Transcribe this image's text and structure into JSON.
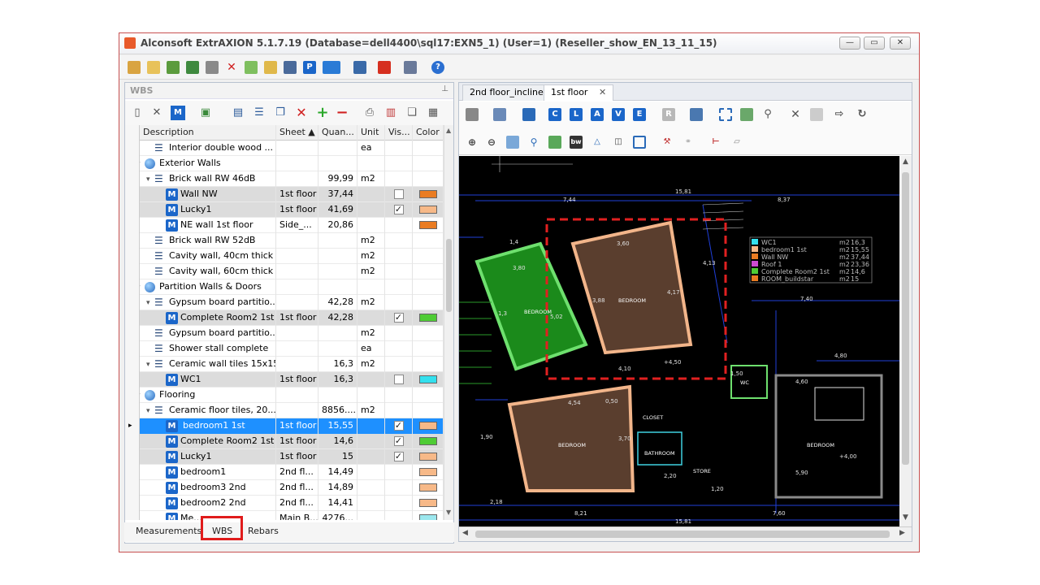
{
  "window": {
    "title": "Alconsoft ExtrAXION 5.1.7.19 (Database=dell4400\\sql17:EXN5_1) (User=1) (Reseller_show_EN_13_11_15)"
  },
  "wbs": {
    "title": "WBS",
    "pin": "⊥",
    "columns": [
      "Description",
      "Sheet ▲",
      "Quan...",
      "Unit",
      "Vis...",
      "Color"
    ],
    "rows": [
      {
        "icon": "list",
        "indent": 2,
        "desc": "Interior double wood ...",
        "sheet": "",
        "qty": "",
        "unit": "ea",
        "vis": "",
        "color": "",
        "style": ""
      },
      {
        "icon": "globe",
        "indent": 1,
        "desc": "Exterior Walls",
        "sheet": "",
        "qty": "",
        "unit": "",
        "vis": "",
        "color": "",
        "style": "",
        "tw": "▾"
      },
      {
        "icon": "list",
        "indent": 2,
        "desc": "Brick wall RW 46dB",
        "sheet": "",
        "qty": "99,99",
        "unit": "m2",
        "vis": "",
        "color": "",
        "style": "",
        "tw": "▾"
      },
      {
        "icon": "m",
        "indent": 3,
        "desc": "Wall NW",
        "sheet": "1st floor",
        "qty": "37,44",
        "unit": "",
        "vis": "☐",
        "color": "#ea7c22",
        "style": "gray"
      },
      {
        "icon": "m",
        "indent": 3,
        "desc": "Lucky1",
        "sheet": "1st floor",
        "qty": "41,69",
        "unit": "",
        "vis": "✓",
        "color": "#f7b988",
        "style": "gray"
      },
      {
        "icon": "m",
        "indent": 3,
        "desc": "NE wall 1st floor",
        "sheet": "Side_...",
        "qty": "20,86",
        "unit": "",
        "vis": "",
        "color": "#ea7c22",
        "style": ""
      },
      {
        "icon": "list",
        "indent": 2,
        "desc": "Brick wall RW 52dB",
        "sheet": "",
        "qty": "",
        "unit": "m2",
        "vis": "",
        "color": "",
        "style": ""
      },
      {
        "icon": "list",
        "indent": 2,
        "desc": "Cavity wall, 40cm thick",
        "sheet": "",
        "qty": "",
        "unit": "m2",
        "vis": "",
        "color": "",
        "style": ""
      },
      {
        "icon": "list",
        "indent": 2,
        "desc": "Cavity wall, 60cm thick",
        "sheet": "",
        "qty": "",
        "unit": "m2",
        "vis": "",
        "color": "",
        "style": ""
      },
      {
        "icon": "globe",
        "indent": 1,
        "desc": "Partition Walls & Doors",
        "sheet": "",
        "qty": "",
        "unit": "",
        "vis": "",
        "color": "",
        "style": "",
        "tw": "▾"
      },
      {
        "icon": "list",
        "indent": 2,
        "desc": "Gypsum board partitio...",
        "sheet": "",
        "qty": "42,28",
        "unit": "m2",
        "vis": "",
        "color": "",
        "style": "",
        "tw": "▾"
      },
      {
        "icon": "m",
        "indent": 3,
        "desc": "Complete Room2 1st",
        "sheet": "1st floor",
        "qty": "42,28",
        "unit": "",
        "vis": "✓",
        "color": "#4fcc35",
        "style": "gray"
      },
      {
        "icon": "list",
        "indent": 2,
        "desc": "Gypsum board partitio...",
        "sheet": "",
        "qty": "",
        "unit": "m2",
        "vis": "",
        "color": "",
        "style": ""
      },
      {
        "icon": "list",
        "indent": 2,
        "desc": "Shower stall complete",
        "sheet": "",
        "qty": "",
        "unit": "ea",
        "vis": "",
        "color": "",
        "style": ""
      },
      {
        "icon": "list",
        "indent": 2,
        "desc": "Ceramic wall tiles 15x15",
        "sheet": "",
        "qty": "16,3",
        "unit": "m2",
        "vis": "",
        "color": "",
        "style": "",
        "tw": "▾"
      },
      {
        "icon": "m",
        "indent": 3,
        "desc": "WC1",
        "sheet": "1st floor",
        "qty": "16,3",
        "unit": "",
        "vis": "☐",
        "color": "#33e0ee",
        "style": "gray"
      },
      {
        "icon": "globe",
        "indent": 1,
        "desc": "Flooring",
        "sheet": "",
        "qty": "",
        "unit": "",
        "vis": "",
        "color": "",
        "style": "",
        "tw": "▾"
      },
      {
        "icon": "list",
        "indent": 2,
        "desc": "Ceramic floor tiles, 20...",
        "sheet": "",
        "qty": "8856....",
        "unit": "m2",
        "vis": "",
        "color": "",
        "style": "",
        "tw": "▾"
      },
      {
        "icon": "m",
        "indent": 3,
        "desc": "bedroom1 1st",
        "sheet": "1st floor",
        "qty": "15,55",
        "unit": "",
        "vis": "✓",
        "color": "#f7b988",
        "style": "sel",
        "ind": "▸"
      },
      {
        "icon": "m",
        "indent": 3,
        "desc": "Complete Room2 1st",
        "sheet": "1st floor",
        "qty": "14,6",
        "unit": "",
        "vis": "✓",
        "color": "#4fcc35",
        "style": "gray"
      },
      {
        "icon": "m",
        "indent": 3,
        "desc": "Lucky1",
        "sheet": "1st floor",
        "qty": "15",
        "unit": "",
        "vis": "✓",
        "color": "#f7b988",
        "style": "gray"
      },
      {
        "icon": "m",
        "indent": 3,
        "desc": "bedroom1",
        "sheet": "2nd fl...",
        "qty": "14,49",
        "unit": "",
        "vis": "",
        "color": "#f7b988",
        "style": ""
      },
      {
        "icon": "m",
        "indent": 3,
        "desc": "bedroom3 2nd",
        "sheet": "2nd fl...",
        "qty": "14,89",
        "unit": "",
        "vis": "",
        "color": "#f7b988",
        "style": ""
      },
      {
        "icon": "m",
        "indent": 3,
        "desc": "bedroom2 2nd",
        "sheet": "2nd fl...",
        "qty": "14,41",
        "unit": "",
        "vis": "",
        "color": "#f7b988",
        "style": ""
      },
      {
        "icon": "m",
        "indent": 3,
        "desc": "Me...",
        "sheet": "Main B...",
        "qty": "4276...",
        "unit": "",
        "vis": "",
        "color": "#9be7ee",
        "style": ""
      }
    ]
  },
  "bottom_tabs": [
    "Measurements",
    "WBS",
    "Rebars"
  ],
  "view": {
    "tabs": [
      "2nd floor_inclined",
      "1st floor"
    ],
    "close": "✕",
    "toolbar_letters": [
      "C",
      "L",
      "A",
      "V",
      "E",
      "R"
    ],
    "legend": [
      {
        "name": "WC1",
        "unit": "m2",
        "value": "16,3",
        "color": "#33e0ee"
      },
      {
        "name": "bedroom1 1st",
        "unit": "m2",
        "value": "15,55",
        "color": "#f7b988"
      },
      {
        "name": "Wall NW",
        "unit": "m2",
        "value": "37,44",
        "color": "#ea7c22"
      },
      {
        "name": "Roof 1",
        "unit": "m2",
        "value": "23,36",
        "color": "#cc4bd1"
      },
      {
        "name": "Complete Room2 1st",
        "unit": "m2",
        "value": "14,6",
        "color": "#4fcc35"
      },
      {
        "name": "ROOM_buildstar",
        "unit": "m2",
        "value": "15",
        "color": "#ea7c22"
      }
    ],
    "dims": [
      "7,44",
      "15,81",
      "8,37",
      "3,80",
      "3,60",
      "1,4",
      "1,3",
      "4,13",
      "7,40",
      "4,80",
      "4,60",
      "4,54",
      "1,90",
      "3,70",
      "5,90",
      "2,20",
      "1,20",
      "2,18",
      "8,21",
      "7,60",
      "15,81",
      "+4,50",
      "+4,00",
      "1,50",
      "4,10",
      "0,50",
      "4,17",
      "3,88",
      "5,02"
    ],
    "rooms": [
      "BEDROOM",
      "BEDROOM",
      "BEDROOM",
      "BEDROOM",
      "WC",
      "CLOSET",
      "BATHROOM",
      "STORE"
    ]
  }
}
